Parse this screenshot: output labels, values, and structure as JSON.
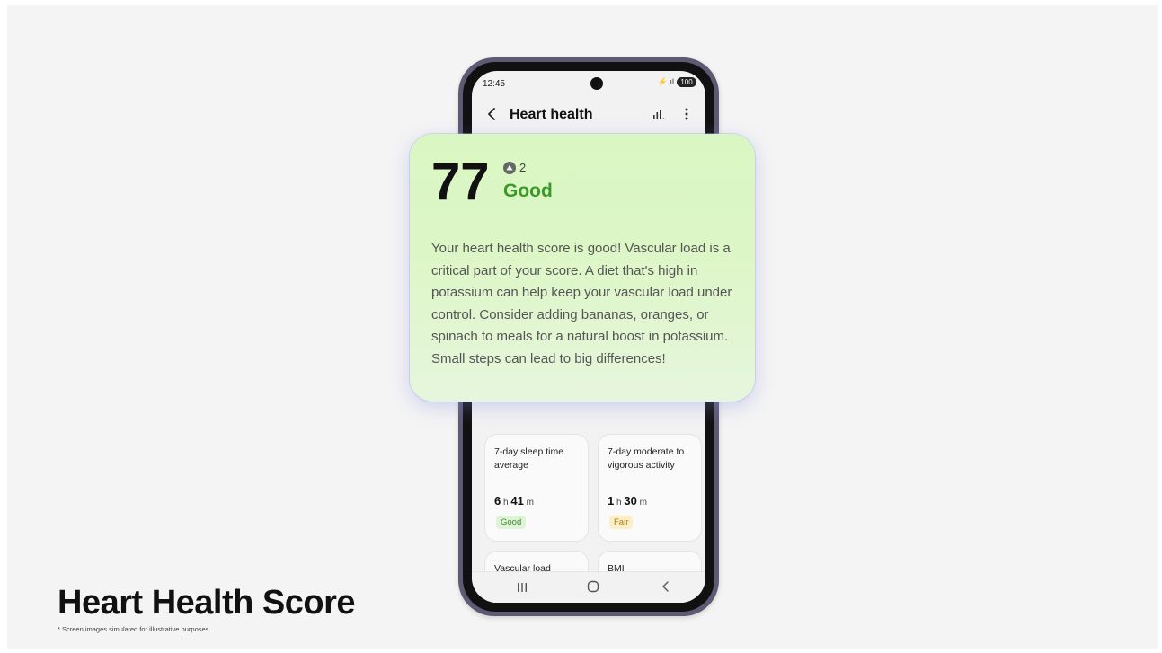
{
  "status_bar": {
    "time": "12:45",
    "battery": "100",
    "signal": "⚡.ıl"
  },
  "app_bar": {
    "title": "Heart health"
  },
  "score_card": {
    "score": "77",
    "trend_value": "2",
    "rating": "Good",
    "message": "Your heart health score is good! Vascular load is a critical part of your score. A diet that's high in potassium can help keep your vascular load under control. Consider adding bananas, oranges, or spinach to meals for a natural boost in potassium. Small steps can lead to big differences!"
  },
  "metrics": [
    {
      "title": "7-day sleep time average",
      "value_major": "6",
      "unit_major": "h",
      "value_minor": "41",
      "unit_minor": "m",
      "badge": "Good"
    },
    {
      "title": "7-day moderate to vigorous activity",
      "value_major": "1",
      "unit_major": "h",
      "value_minor": "30",
      "unit_minor": "m",
      "badge": "Fair"
    },
    {
      "title": "Vascular load"
    },
    {
      "title": "BMI"
    }
  ],
  "caption": {
    "headline": "Heart Health Score",
    "disclaimer": "* Screen images simulated for illustrative purposes."
  },
  "colors": {
    "good_text": "#3a9a25",
    "card_gradient_top": "#d9f7c3",
    "phone_frame": "#5d5a73"
  }
}
